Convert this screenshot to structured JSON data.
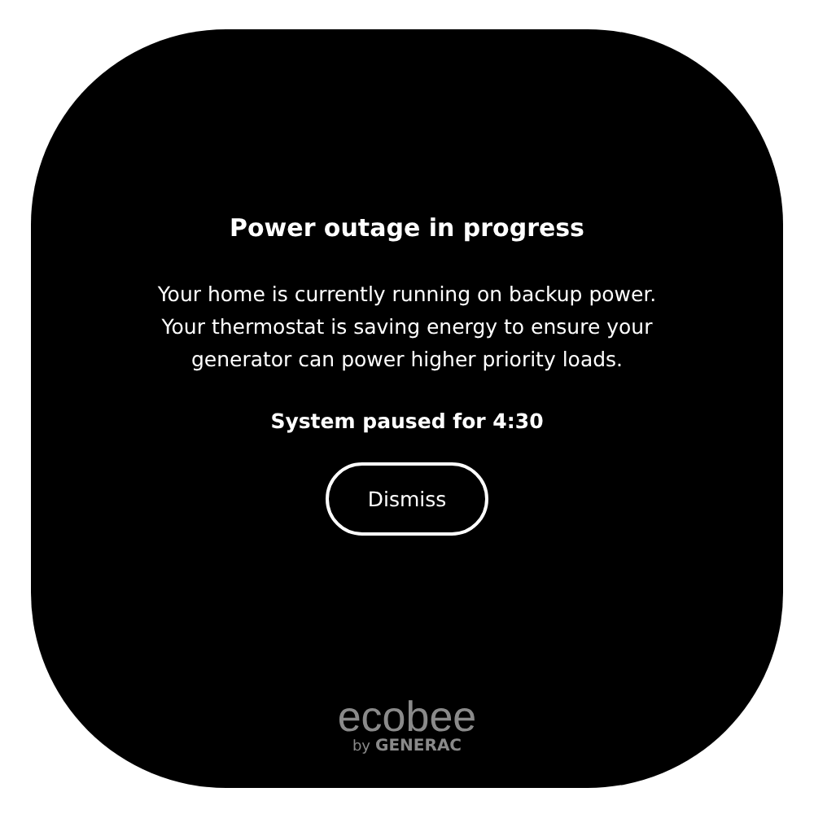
{
  "alert": {
    "title": "Power outage in progress",
    "message": "Your home is currently running on backup power. Your thermostat is saving energy to ensure your generator can power higher priority loads.",
    "status": "System paused for 4:30",
    "button": "Dismiss"
  },
  "brand": {
    "name": "ecobee",
    "tagline_prefix": "by",
    "tagline": "GENERAC"
  }
}
